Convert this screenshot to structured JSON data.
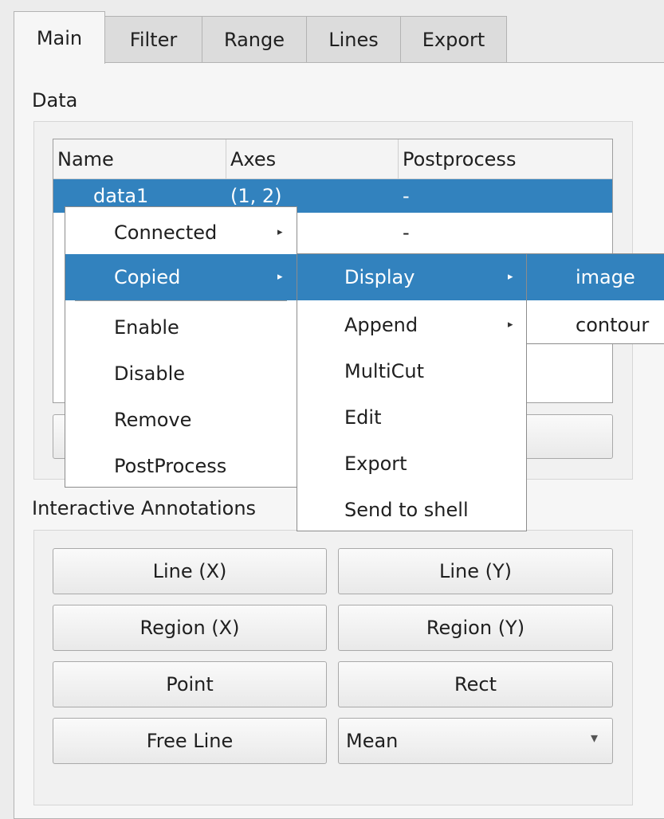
{
  "tabs": [
    "Main",
    "Filter",
    "Range",
    "Lines",
    "Export"
  ],
  "data_group": {
    "label": "Data",
    "columns": [
      "Name",
      "Axes",
      "Postprocess"
    ],
    "rows": [
      {
        "name": "data1",
        "axes": "(1, 2)",
        "postprocess": "-"
      },
      {
        "name": "",
        "axes": "",
        "postprocess": "-"
      }
    ]
  },
  "context_menu": {
    "items": [
      "Connected",
      "Copied",
      "Enable",
      "Disable",
      "Remove",
      "PostProcess"
    ],
    "submenu_arrow": "▸"
  },
  "copied_submenu": {
    "items": [
      "Display",
      "Append",
      "MultiCut",
      "Edit",
      "Export",
      "Send to shell"
    ]
  },
  "display_submenu": {
    "items": [
      "image",
      "contour"
    ]
  },
  "annotations": {
    "label": "Interactive Annotations",
    "buttons": [
      "Line (X)",
      "Line (Y)",
      "Region (X)",
      "Region (Y)",
      "Point",
      "Rect",
      "Free Line"
    ],
    "combo_value": "Mean",
    "combo_arrow": "▾"
  },
  "colors": {
    "selection": "#3282be",
    "background": "#ececec"
  }
}
